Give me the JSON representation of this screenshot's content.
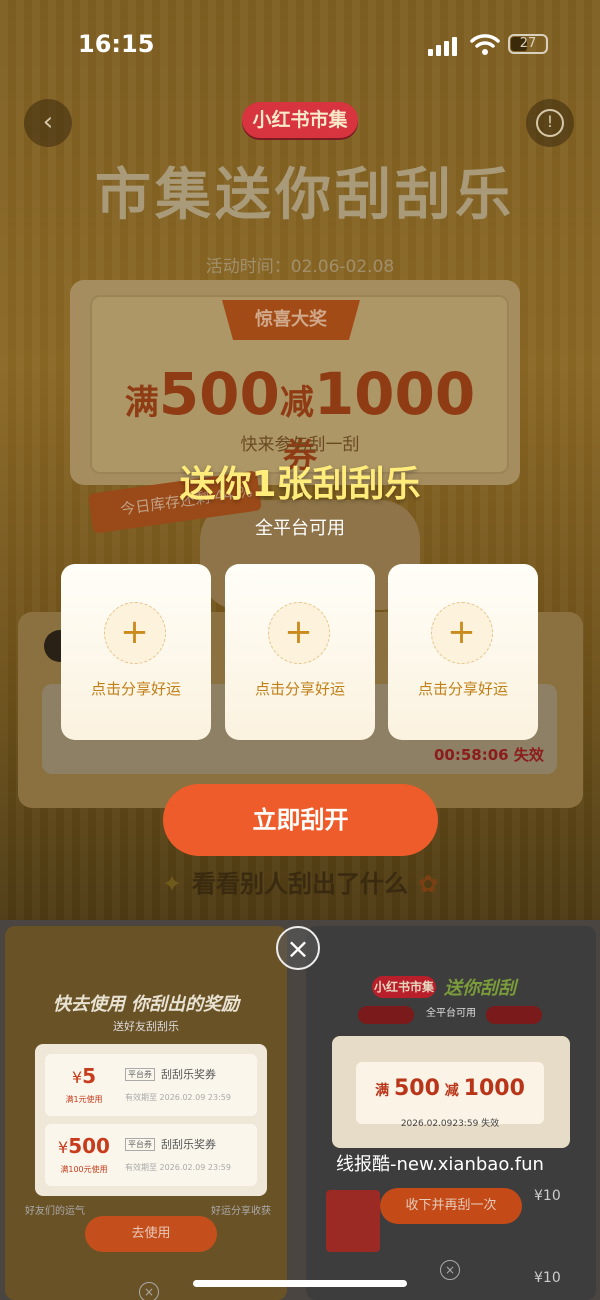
{
  "status_bar": {
    "time": "16:15",
    "battery": "27"
  },
  "page": {
    "back_icon": "chevron-left-icon",
    "info_icon": "info-icon",
    "brand": "小红书市集",
    "headline": "市集送你刮刮乐",
    "activity_time": "活动时间：02.06-02.08",
    "prize_tag": "惊喜大奖",
    "prize": {
      "prefix": "满",
      "threshold": "500",
      "mid": "减",
      "amount": "1000",
      "suffix": "券"
    },
    "join_text": "快来参与刮一刮",
    "stock_text": "今日库存还剩 44 %",
    "countdown": "00:58:06 失效",
    "others_title": "看看别人刮出了什么"
  },
  "modal": {
    "title": "送你1张刮刮乐",
    "subtitle": "全平台可用",
    "slots": [
      {
        "label": "点击分享好运"
      },
      {
        "label": "点击分享好运"
      },
      {
        "label": "点击分享好运"
      }
    ],
    "cta_label": "立即刮开",
    "colors": {
      "cta": "#ed5c2a",
      "title": "#ffec7a"
    }
  },
  "bottom": {
    "left_panel": {
      "title": "快去使用 你刮出的奖励",
      "subtitle": "送好友刮刮乐",
      "coupons": [
        {
          "symbol": "¥",
          "value": "5",
          "cond": "满1元使用",
          "platform": "平台券",
          "title": "刮刮乐奖券",
          "valid": "有效期至 2026.02.09 23:59"
        },
        {
          "symbol": "¥",
          "value": "500",
          "cond": "满100元使用",
          "platform": "平台券",
          "title": "刮刮乐奖券",
          "valid": "有效期至 2026.02.09 23:59"
        }
      ],
      "use_button": "去使用",
      "bottom_left": "好友们的运气",
      "bottom_right": "好运分享收获"
    },
    "right_panel": {
      "brand": "小红书市集",
      "slogan": "送你刮刮",
      "subtitle": "全平台可用",
      "prize": {
        "prefix": "满",
        "threshold": "500",
        "mid": "减",
        "amount": "1000"
      },
      "expire": "2026.02.0923:59 失效",
      "button": "收下并再刮一次",
      "price1": "¥10",
      "price2": "¥10"
    },
    "close_icon": "close-icon",
    "watermark": "线报酷-new.xianbao.fun"
  }
}
